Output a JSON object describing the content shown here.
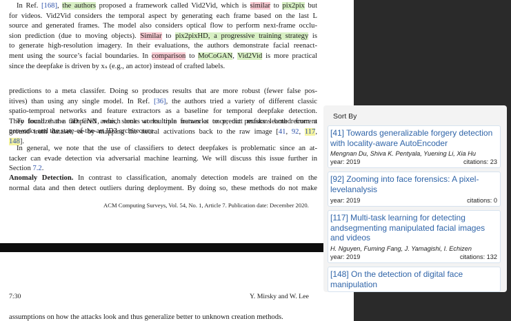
{
  "paper": {
    "para1": [
      [
        "In Ref. ",
        {
          "t": "[168]",
          "c": "link-blue"
        },
        ", ",
        {
          "t": "the authors",
          "c": "hl-green"
        },
        " proposed a framework called Vid2Vid, which is ",
        {
          "t": "similar",
          "c": "hl-pink"
        },
        " to ",
        {
          "t": "pix2pix",
          "c": "hl-green"
        },
        " but"
      ],
      [
        "for videos. Vid2Vid considers the temporal aspect by generating each frame based on the last L"
      ],
      [
        "source and generated frames. The model also considers optical flow to perform next-frame occlu-"
      ],
      [
        "sion prediction (due to moving objects). ",
        {
          "t": "Similar",
          "c": "hl-pink"
        },
        " to ",
        {
          "t": "pix2pixHD, a progressive training strategy",
          "c": "hl-green"
        },
        " is"
      ],
      [
        "to generate high-resolution imagery. In their evaluations, the authors demonstrate facial reenact-"
      ],
      [
        "ment using the source’s facial boundaries. In ",
        {
          "t": "comparison",
          "c": "hl-pink"
        },
        " to ",
        {
          "t": "MoCoGAN",
          "c": "hl-green"
        },
        ", ",
        {
          "t": "Vid2Vid",
          "c": "hl-green"
        },
        " is more practical"
      ],
      [
        "since the deepfake is driven by xₛ (e.g., an actor) instead of crafted labels."
      ]
    ],
    "para2": [
      [
        "predictions to a meta classifer. Doing so produces results that are more robust (fewer false pos-"
      ],
      [
        "itives) than using any single model. In Ref. ",
        {
          "t": "[36]",
          "c": "link-blue"
        },
        ", the authors tried a variety of different classic"
      ],
      [
        "spatio-temproal networks and feature extractors as a baseline for temporal deepfake detection."
      ],
      [
        "They found that a 3D CNN, which looks at multiple frames at once, out performs both recurrent"
      ],
      [
        "networks and the state-of-the-art ID3 architecture."
      ]
    ],
    "para3": [
      [
        "To localize the tampered areas, some works train networks to predict masks learned from a"
      ],
      [
        "ground truth dataset, or by mapping the neural activations back to the raw image [",
        {
          "t": "41",
          "c": "link-blue"
        },
        ", ",
        {
          "t": "92",
          "c": "link-blue"
        },
        ", ",
        {
          "t": "117",
          "c": "hl-yellow link-blue"
        },
        ","
      ],
      [
        {
          "t": "148",
          "c": "hl-yellow link-blue"
        },
        "]."
      ]
    ],
    "para4": [
      [
        "In general, we note that the use of classifiers to detect deepfakes is problematic since an at-"
      ],
      [
        "tacker can evade detection via adversarial machine learning. We will discuss this issue further in"
      ],
      [
        "Section ",
        {
          "t": "7.2",
          "c": "link-blue"
        },
        "."
      ]
    ],
    "para5": [
      [
        {
          "t": "Anomaly Detection.",
          "c": "bold"
        },
        " In contrast to classification, anomaly detection models are trained on the"
      ],
      [
        "normal data and then detect outliers during deployment. By doing so, these methods do not make"
      ]
    ],
    "footer": "ACM Computing Surveys, Vol. 54, No. 1, Article 7. Publication date: December 2020.",
    "page_number": "7:30",
    "running_authors": "Y. Mirsky and W. Lee",
    "next_page_text": "assumptions on how the attacks look and thus generalize better to unknown creation methods."
  },
  "panel": {
    "sort_label": "Sort By",
    "cards": [
      {
        "title": "[41] Towards generalizable forgery detection with locality-aware AutoEncoder",
        "authors": "Mengnan Du, Shiva K. Pentyala, Yuening Li, Xia Hu",
        "year": "year: 2019",
        "citations": "citations: 23"
      },
      {
        "title": "[92] Zooming into face forensics: A pixel-levelanalysis",
        "authors": "",
        "year": "year: 2019",
        "citations": "citations: 0"
      },
      {
        "title": "[117] Multi-task learning for detecting andsegmenting manipulated facial images and videos",
        "authors": "H. Nguyen, Fuming Fang, J. Yamagishi, I. Echizen",
        "year": "year: 2019",
        "citations": "citations: 132"
      },
      {
        "title": "[148] On the detection of digital face manipulation",
        "authors": "",
        "year": "",
        "citations": ""
      }
    ]
  }
}
